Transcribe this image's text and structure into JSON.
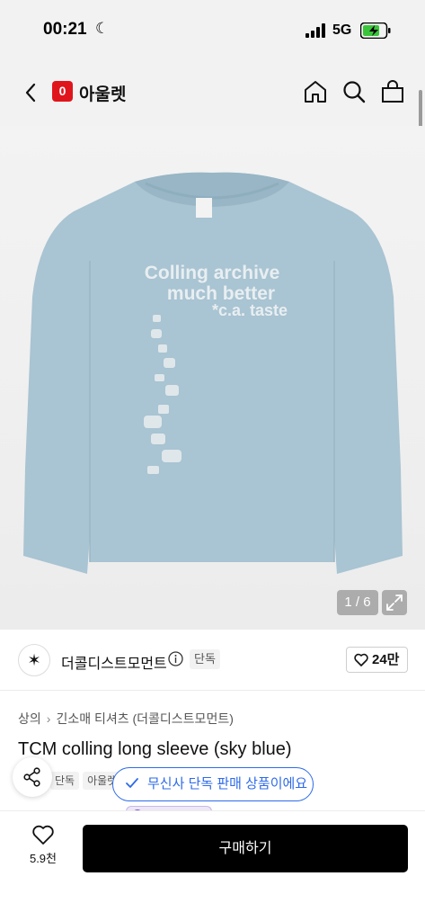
{
  "status_bar": {
    "time": "00:21",
    "network": "5G",
    "battery_charging": true
  },
  "nav": {
    "brand_badge": "0",
    "title": "아울렛"
  },
  "gallery": {
    "counter": "1 / 6",
    "print_lines": [
      "Colling archive",
      "much better",
      "*c.a. taste"
    ],
    "shirt_color": "#a9c4d2"
  },
  "brand": {
    "name": "더콜디스트모먼트",
    "tag": "단독",
    "likes": "24만"
  },
  "breadcrumb": [
    "상의",
    "긴소매 티셔츠 (더콜디스트모먼트)"
  ],
  "product": {
    "title": "TCM colling long sleeve (sky blue)",
    "tags": [
      "단독",
      "아울렛"
    ]
  },
  "tooltip": {
    "text": "무신사 단독 판매 상품이에요"
  },
  "bottom_bar": {
    "like_count": "5.9천",
    "buy_label": "구매하기"
  },
  "colors": {
    "accent_red": "#e0151c",
    "tooltip_blue": "#2f6be8",
    "buy_button": "#000000"
  }
}
